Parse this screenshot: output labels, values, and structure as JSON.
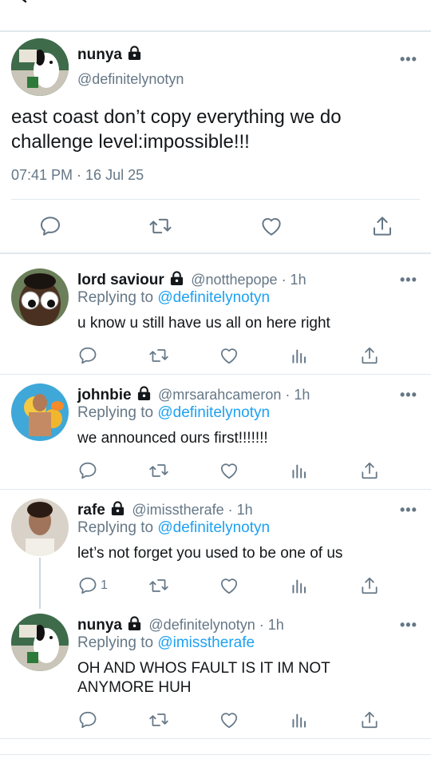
{
  "main_tweet": {
    "name": "nunya",
    "handle": "@definitelynotyn",
    "text_line1": "east coast don’t copy everything we do",
    "text_line2": "challenge level:impossible!!!",
    "timestamp": "07:41 PM · 16 Jul 25",
    "more": "•••"
  },
  "replies": [
    {
      "name": "lord saviour",
      "handle_time": "@notthepope · 1h",
      "replying_prefix": "Replying to ",
      "replying_to": "@definitelynotyn",
      "text": "u know u still have us all on here right",
      "reply_count": ""
    },
    {
      "name": "johnbie",
      "handle_time": "@mrsarahcameron · 1h",
      "replying_prefix": "Replying to ",
      "replying_to": "@definitelynotyn",
      "text": "we announced ours first!!!!!!!",
      "reply_count": ""
    },
    {
      "name": "rafe",
      "handle_time": "@imisstherafe · 1h",
      "replying_prefix": "Replying to ",
      "replying_to": "@definitelynotyn",
      "text": "let’s not forget you used to be one of us",
      "reply_count": "1"
    },
    {
      "name": "nunya",
      "handle_time": "@definitelynotyn · 1h",
      "replying_prefix": "Replying to ",
      "replying_to": "@imisstherafe",
      "text_line1": "OH AND WHOS FAULT IS IT IM NOT",
      "text_line2": "ANYMORE HUH",
      "reply_count": ""
    }
  ],
  "colors": {
    "link": "#1da1f2",
    "secondary": "#657786",
    "divider": "#e1e8ed"
  },
  "icons": [
    "back-arrow-icon",
    "lock-icon",
    "more-icon",
    "reply-icon",
    "retweet-icon",
    "like-icon",
    "share-icon",
    "analytics-icon"
  ]
}
